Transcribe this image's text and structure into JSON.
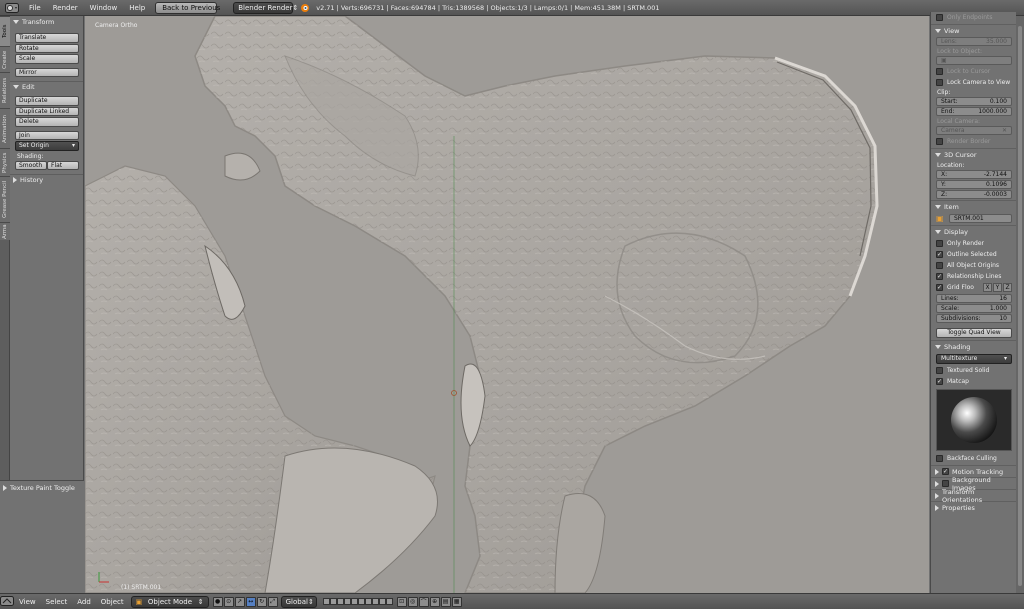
{
  "top_menu": {
    "items": [
      "File",
      "Render",
      "Window",
      "Help"
    ],
    "back_button": "Back to Previous",
    "engine": "Blender Render",
    "stats": "v2.71 | Verts:696731 | Faces:694784 | Tris:1389568 | Objects:1/3 | Lamps:0/1 | Mem:451.38M | SRTM.001"
  },
  "tool_tabs": [
    "Tools",
    "Create",
    "Relations",
    "Animation",
    "Physics",
    "Grease Pencil",
    "Arma"
  ],
  "tool_shelf": {
    "transform": {
      "title": "Transform",
      "buttons": [
        "Translate",
        "Rotate",
        "Scale",
        "Mirror"
      ]
    },
    "edit": {
      "title": "Edit",
      "buttons": [
        "Duplicate",
        "Duplicate Linked",
        "Delete",
        "Join"
      ],
      "set_origin": "Set Origin",
      "shading_label": "Shading:",
      "smooth": "Smooth",
      "flat": "Flat"
    },
    "history": "History",
    "operator": "Texture Paint Toggle"
  },
  "viewport": {
    "view_label": "Camera Ortho",
    "object_label": "(1) SRTM.001"
  },
  "right_panel": {
    "only_endpoints": "Only Endpoints",
    "view": {
      "title": "View",
      "lens_label": "Lens:",
      "lens_value": "35.000",
      "lock_object": "Lock to Object:",
      "lock_cursor": "Lock to Cursor",
      "lock_camera": "Lock Camera to View",
      "clip": "Clip:",
      "start_label": "Start:",
      "start_value": "0.100",
      "end_label": "End:",
      "end_value": "1000.000",
      "local_camera": "Local Camera:",
      "camera": "Camera",
      "render_border": "Render Border"
    },
    "cursor": {
      "title": "3D Cursor",
      "location": "Location:",
      "x_label": "X:",
      "x_value": "-2.7144",
      "y_label": "Y:",
      "y_value": "0.1096",
      "z_label": "Z:",
      "z_value": "-0.0003"
    },
    "item": {
      "title": "Item",
      "name": "SRTM.001"
    },
    "display": {
      "title": "Display",
      "only_render": "Only Render",
      "outline_selected": "Outline Selected",
      "all_origins": "All Object Origins",
      "relationship_lines": "Relationship Lines",
      "grid_floor": "Grid Floo",
      "axes": [
        "X",
        "Y",
        "Z"
      ],
      "lines_label": "Lines:",
      "lines_value": "16",
      "scale_label": "Scale:",
      "scale_value": "1.000",
      "subdiv_label": "Subdivisions:",
      "subdiv_value": "10",
      "toggle_quad": "Toggle Quad View"
    },
    "shading": {
      "title": "Shading",
      "mode": "Multitexture",
      "textured_solid": "Textured Solid",
      "matcap": "Matcap",
      "backface": "Backface Culling"
    },
    "motion_tracking": "Motion Tracking",
    "background_images": "Background Images",
    "transform_orientations": "Transform Orientations",
    "properties": "Properties"
  },
  "bottom_bar": {
    "menus": [
      "View",
      "Select",
      "Add",
      "Object"
    ],
    "mode": "Object Mode",
    "orientation": "Global"
  },
  "colors": {
    "accent": "#5680c2",
    "terrain": "#aaa6a1",
    "background": "#727272"
  }
}
